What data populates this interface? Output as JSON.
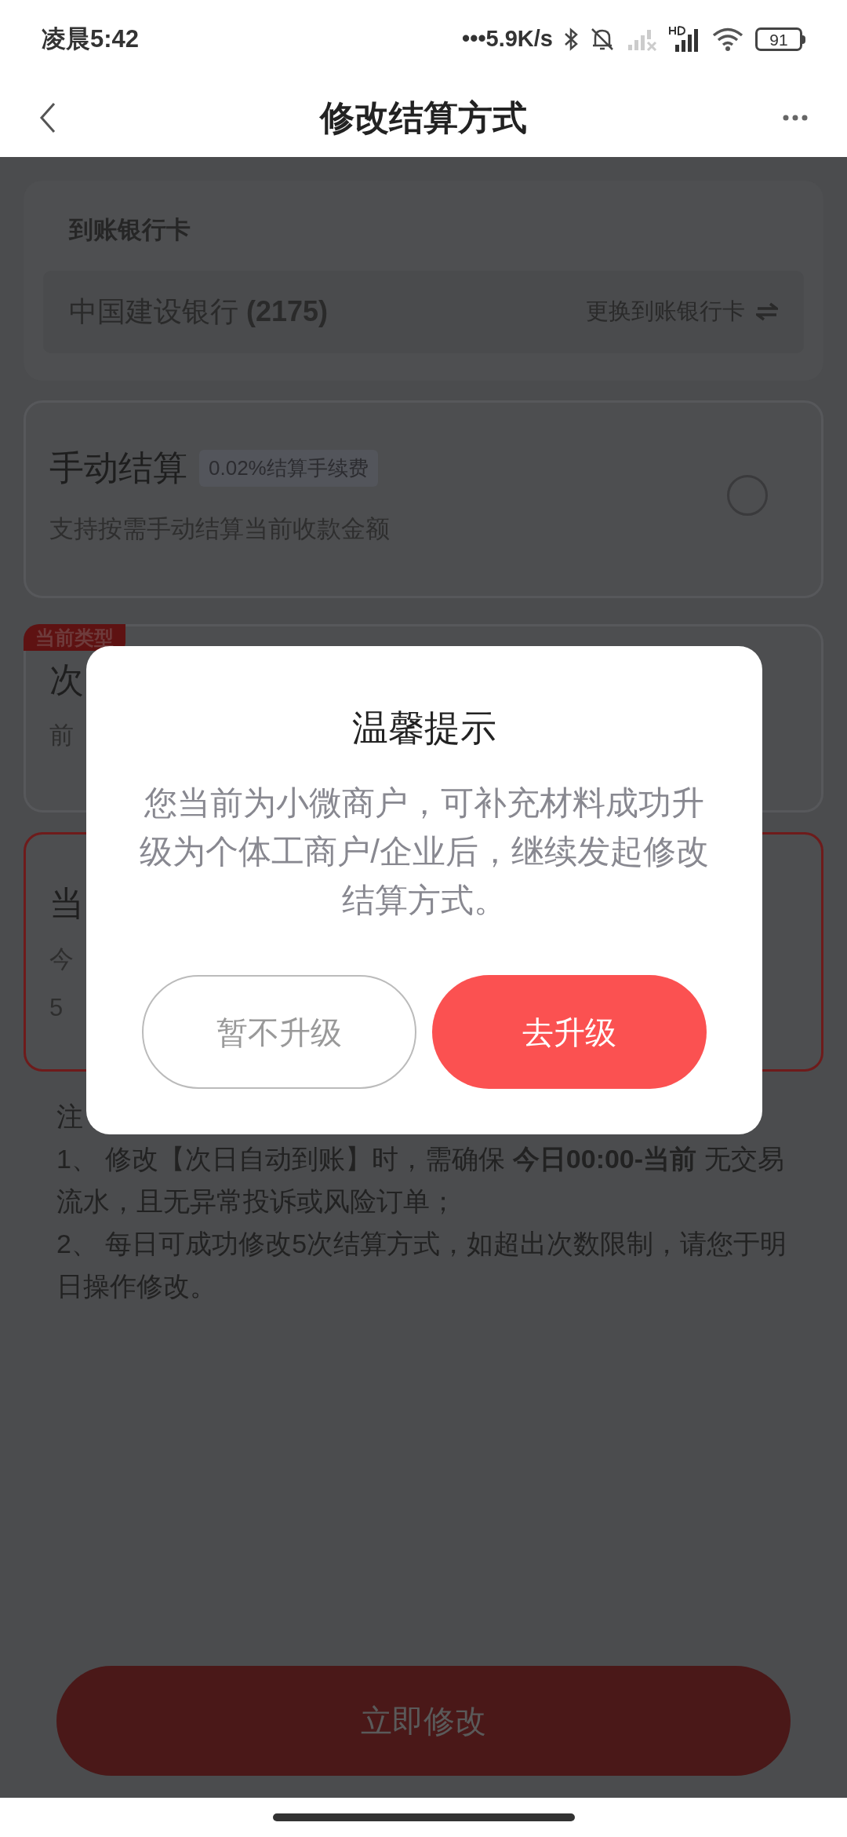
{
  "status_bar": {
    "time": "凌晨5:42",
    "network_speed": "•••5.9K/s",
    "battery": "91"
  },
  "header": {
    "title": "修改结算方式"
  },
  "bank_card": {
    "title": "到账银行卡",
    "bank": "中国建设银行 **(2175)**",
    "change_link": "更换到账银行卡"
  },
  "options": [
    {
      "kind": "full",
      "title": "手动结算",
      "tag": "0.02%结算手续费",
      "lines": [
        "支持按需手动结算当前收款金额"
      ],
      "selected": false
    },
    {
      "kind": "covered",
      "badge": "当前类型",
      "title": "次",
      "lines": [
        "前"
      ],
      "selected": false
    },
    {
      "kind": "covered",
      "title": "当",
      "lines": [
        "今",
        "5"
      ],
      "selected": true
    }
  ],
  "notes": {
    "heading": "注",
    "items": [
      "1、 修改【次日自动到账】时，需确保 **今日00:00-当前** 无交易流水，且无异常投诉或风险订单；",
      "2、 每日可成功修改5次结算方式，如超出次数限制，请您于明日操作修改。"
    ]
  },
  "submit_button": "立即修改",
  "dialog": {
    "title": "温馨提示",
    "message": "您当前为小微商户，可补充材料成功升级为个体工商户/企业后，继续发起修改结算方式。",
    "buttons": [
      {
        "label": "暂不升级",
        "kind": "secondary"
      },
      {
        "label": "去升级",
        "kind": "primary"
      }
    ]
  }
}
